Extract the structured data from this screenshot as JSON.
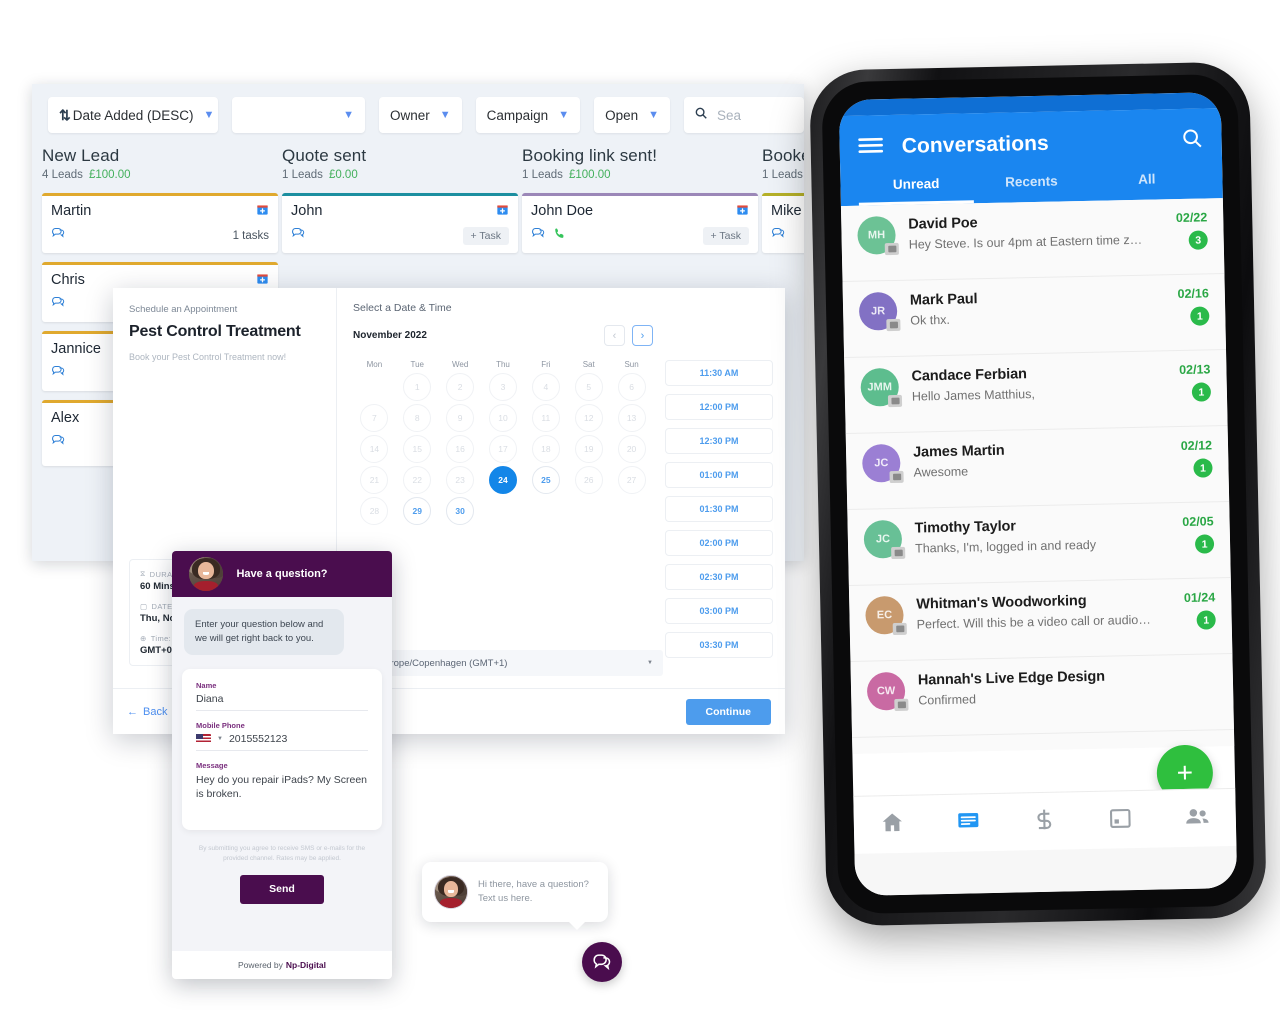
{
  "crm": {
    "toolbar": {
      "sort_label": "Date Added (DESC)",
      "blank_label": "",
      "owner_label": "Owner",
      "campaign_label": "Campaign",
      "open_label": "Open",
      "search_placeholder": "Sea",
      "sort_icon": "sort-descending-icon",
      "search_icon": "search-icon",
      "chevron_icon": "chevron-down-icon"
    },
    "columns": [
      {
        "title": "New Lead",
        "leads_count": "4 Leads",
        "amount": "£100.00",
        "accent": "#e0a92e",
        "cards": [
          {
            "name": "Martin",
            "meta": "1 tasks",
            "task_btn": "",
            "has_phone": false
          },
          {
            "name": "Chris",
            "meta": "",
            "task_btn": "",
            "has_phone": false
          },
          {
            "name": "Jannice",
            "meta": "",
            "task_btn": "",
            "has_phone": false
          },
          {
            "name": "Alex",
            "meta": "",
            "task_btn": "",
            "has_phone": false
          }
        ]
      },
      {
        "title": "Quote sent",
        "leads_count": "1 Leads",
        "amount": "£0.00",
        "accent": "#1c8fa0",
        "cards": [
          {
            "name": "John",
            "meta": "",
            "task_btn": "+ Task",
            "has_phone": false
          }
        ]
      },
      {
        "title": "Booking link sent!",
        "leads_count": "1 Leads",
        "amount": "£100.00",
        "accent": "#9b87b8",
        "cards": [
          {
            "name": "John Doe",
            "meta": "",
            "task_btn": "+ Task",
            "has_phone": true
          }
        ]
      },
      {
        "title": "Booked",
        "leads_count": "1 Leads",
        "amount": "",
        "accent": "#b5b028",
        "cards": [
          {
            "name": "Mike",
            "meta": "",
            "task_btn": "",
            "has_phone": false
          }
        ]
      }
    ]
  },
  "booking": {
    "eyebrow": "Schedule an Appointment",
    "title": "Pest Control Treatment",
    "description": "Book your Pest Control Treatment now!",
    "meta": {
      "duration_label": "DURA",
      "duration_value": "60 Mins",
      "date_label": "DATE",
      "date_value": "Thu, Nov",
      "timezone_label": "Time:",
      "timezone_value": "GMT+01:"
    },
    "back_label": "Back",
    "continue_label": "Continue",
    "calendar": {
      "heading": "Select a Date & Time",
      "month": "November 2022",
      "prev_icon": "chevron-left-icon",
      "next_icon": "chevron-right-icon",
      "dow": [
        "Mon",
        "Tue",
        "Wed",
        "Thu",
        "Fri",
        "Sat",
        "Sun"
      ],
      "leading_blanks": 1,
      "days": [
        {
          "n": 1,
          "state": "disabled"
        },
        {
          "n": 2,
          "state": "disabled"
        },
        {
          "n": 3,
          "state": "disabled"
        },
        {
          "n": 4,
          "state": "disabled"
        },
        {
          "n": 5,
          "state": "disabled"
        },
        {
          "n": 6,
          "state": "disabled"
        },
        {
          "n": 7,
          "state": "disabled"
        },
        {
          "n": 8,
          "state": "disabled"
        },
        {
          "n": 9,
          "state": "disabled"
        },
        {
          "n": 10,
          "state": "disabled"
        },
        {
          "n": 11,
          "state": "disabled"
        },
        {
          "n": 12,
          "state": "disabled"
        },
        {
          "n": 13,
          "state": "disabled"
        },
        {
          "n": 14,
          "state": "disabled"
        },
        {
          "n": 15,
          "state": "disabled"
        },
        {
          "n": 16,
          "state": "disabled"
        },
        {
          "n": 17,
          "state": "disabled"
        },
        {
          "n": 18,
          "state": "disabled"
        },
        {
          "n": 19,
          "state": "disabled"
        },
        {
          "n": 20,
          "state": "disabled"
        },
        {
          "n": 21,
          "state": "disabled"
        },
        {
          "n": 22,
          "state": "disabled"
        },
        {
          "n": 23,
          "state": "disabled"
        },
        {
          "n": 24,
          "state": "sel"
        },
        {
          "n": 25,
          "state": "avail"
        },
        {
          "n": 26,
          "state": "disabled"
        },
        {
          "n": 27,
          "state": "disabled"
        },
        {
          "n": 28,
          "state": "disabled"
        },
        {
          "n": 29,
          "state": "avail"
        },
        {
          "n": 30,
          "state": "avail"
        }
      ]
    },
    "slots": [
      "11:30 AM",
      "12:00 PM",
      "12:30 PM",
      "01:00 PM",
      "01:30 PM",
      "02:00 PM",
      "02:30 PM",
      "03:00 PM",
      "03:30 PM"
    ],
    "timezone_select": ":00 Europe/Copenhagen (GMT+1)"
  },
  "chat_form": {
    "header_title": "Have a question?",
    "avatar_icon": "agent-avatar",
    "greeting": "Enter your question below and we will get right back to you.",
    "fields": {
      "name_label": "Name",
      "name_value": "Diana",
      "phone_label": "Mobile Phone",
      "phone_value": "2015552123",
      "flag_icon": "us-flag-icon",
      "message_label": "Message",
      "message_value": "Hey do you repair iPads? My Screen is broken."
    },
    "terms": "By submitting you agree to receive SMS or e-mails for the provided channel. Rates may be applied.",
    "send_label": "Send",
    "powered_prefix": "Powered by",
    "powered_brand": "Np-Digital"
  },
  "chat_bubble": {
    "text": "Hi there, have a question? Text us here.",
    "fab_icon": "chat-icon",
    "avatar_icon": "agent-avatar"
  },
  "phone": {
    "app_title": "Conversations",
    "menu_icon": "hamburger-menu-icon",
    "search_icon": "search-icon",
    "tabs": [
      {
        "label": "Unread",
        "active": true
      },
      {
        "label": "Recents",
        "active": false
      },
      {
        "label": "All",
        "active": false
      }
    ],
    "conversations": [
      {
        "initials": "MH",
        "color_class": "gA",
        "name": "David Poe",
        "preview": "Hey Steve.  Is our 4pm at Eastern time zo…",
        "date": "02/22",
        "badge": "3"
      },
      {
        "initials": "JR",
        "color_class": "gB",
        "name": "Mark Paul",
        "preview": "Ok thx.",
        "date": "02/16",
        "badge": "1"
      },
      {
        "initials": "JMM",
        "color_class": "gC",
        "name": "Candace Ferbian",
        "preview": "Hello James Matthius,",
        "date": "02/13",
        "badge": "1"
      },
      {
        "initials": "JC",
        "color_class": "gD",
        "name": "James Martin",
        "preview": "Awesome",
        "date": "02/12",
        "badge": "1"
      },
      {
        "initials": "JC",
        "color_class": "gE",
        "name": "Timothy Taylor",
        "preview": "Thanks, I'm, logged in and ready",
        "date": "02/05",
        "badge": "1"
      },
      {
        "initials": "EC",
        "color_class": "gF",
        "name": "Whitman's Woodworking",
        "preview": "Perfect. Will this be a video call or audio …",
        "date": "01/24",
        "badge": "1"
      },
      {
        "initials": "CW",
        "color_class": "gG",
        "name": "Hannah's Live Edge Design",
        "preview": "Confirmed",
        "date": "",
        "badge": ""
      }
    ],
    "fab_label": "+",
    "nav": [
      {
        "icon": "home-icon",
        "active": false
      },
      {
        "icon": "messages-icon",
        "active": true
      },
      {
        "icon": "dollar-icon",
        "active": false
      },
      {
        "icon": "calendar-icon",
        "active": false
      },
      {
        "icon": "contacts-icon",
        "active": false
      }
    ]
  },
  "colors": {
    "phone_blue": "#1a86f0",
    "badge_green": "#2aba4a",
    "date_green": "#2aa745",
    "brand_purple": "#4a0d4e",
    "link_blue": "#4d9ced",
    "money_green": "#43b05c"
  }
}
